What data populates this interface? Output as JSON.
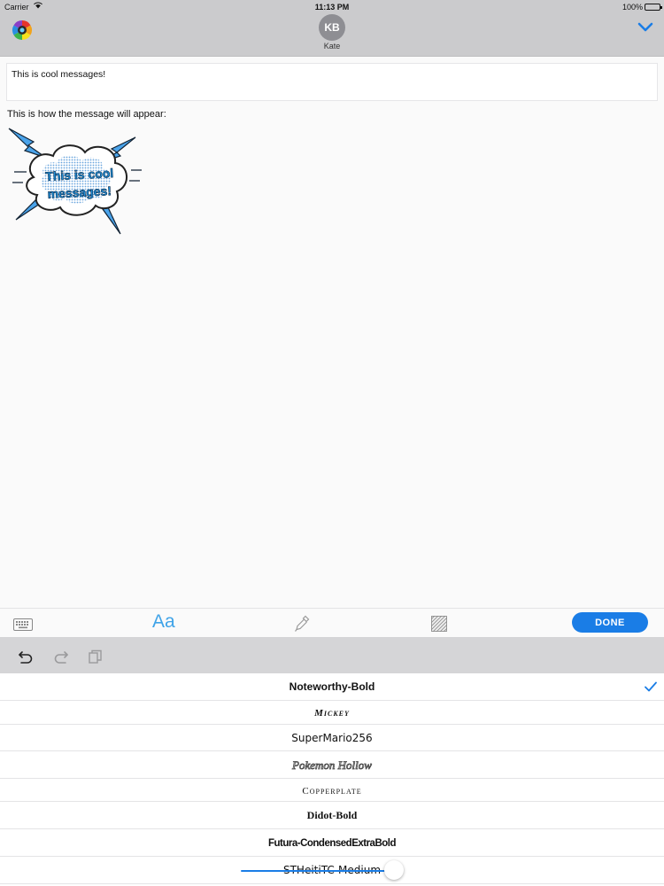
{
  "status_bar": {
    "carrier": "Carrier",
    "time": "11:13 PM",
    "battery": "100%"
  },
  "header": {
    "app_icon": "color-wheel-icon",
    "avatar_initials": "KB",
    "contact_name": "Kate",
    "collapse_icon": "chevron-down-icon"
  },
  "message": {
    "text": "This is cool messages!",
    "preview_label": "This is how the message will appear:",
    "sticker_text_line1": "This is cool",
    "sticker_text_line2": "messages!"
  },
  "toolbar": {
    "font_label": "Aa",
    "done_label": "DONE",
    "icons": [
      "keyboard-icon",
      "font-icon",
      "eyedropper-icon",
      "pattern-icon"
    ]
  },
  "edit_bar": {
    "icons": [
      "undo-icon",
      "redo-icon",
      "copy-icon"
    ]
  },
  "fonts": [
    {
      "name": "Noteworthy-Bold",
      "selected": true
    },
    {
      "name": "Mickey",
      "selected": false
    },
    {
      "name": "SuperMario256",
      "selected": false
    },
    {
      "name": "Pokemon Hollow",
      "selected": false
    },
    {
      "name": "Copperplate",
      "selected": false
    },
    {
      "name": "Didot-Bold",
      "selected": false
    },
    {
      "name": "Futura-CondensedExtraBold",
      "selected": false
    },
    {
      "name": "STHeitiTC-Medium",
      "selected": false
    }
  ],
  "slider": {
    "value": 0.88
  },
  "colors": {
    "accent": "#1a7de6",
    "font_icon": "#3fa3e8",
    "bar_background": "#cbcbcd"
  }
}
